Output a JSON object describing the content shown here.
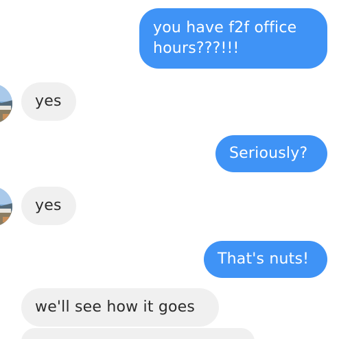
{
  "conversation": {
    "messages": [
      {
        "direction": "outgoing",
        "line1": "you have f2f office",
        "line2": "hours???!!!"
      },
      {
        "direction": "incoming",
        "text": "yes"
      },
      {
        "direction": "outgoing",
        "text": "Seriously?"
      },
      {
        "direction": "incoming",
        "text": "yes"
      },
      {
        "direction": "outgoing",
        "text": "That's nuts!"
      },
      {
        "direction": "incoming",
        "text": "we'll see how it goes"
      }
    ]
  },
  "colors": {
    "outgoing_bubble": "#3f93f6",
    "incoming_bubble": "#f0f0f0",
    "outgoing_text": "#ffffff",
    "incoming_text": "#2b2b2b"
  },
  "icons": {
    "avatar": "contact-avatar-photo"
  }
}
